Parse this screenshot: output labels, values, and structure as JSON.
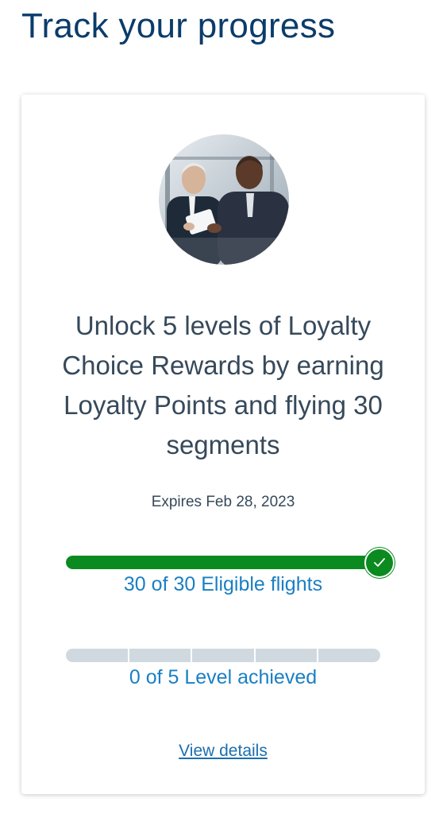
{
  "page": {
    "title": "Track your progress"
  },
  "card": {
    "image_icon": "business-people-photo",
    "headline": "Unlock 5 levels of Loyalty Choice Rewards by earning Loyalty Points and flying 30 segments",
    "expires": "Expires Feb 28, 2023",
    "flights": {
      "label": "30 of 30 Eligible flights",
      "completed": 30,
      "required": 30,
      "progress_fraction": 1.0,
      "complete_icon": "checkmark-icon"
    },
    "levels": {
      "label": "0 of 5 Level achieved",
      "achieved": 0,
      "total": 5
    },
    "view_details_label": "View details"
  },
  "colors": {
    "title": "#0b3c6a",
    "progress_complete": "#0b8a1f",
    "progress_empty": "#d0d9e0",
    "link": "#1a7fc4",
    "body_text": "#36495a"
  }
}
